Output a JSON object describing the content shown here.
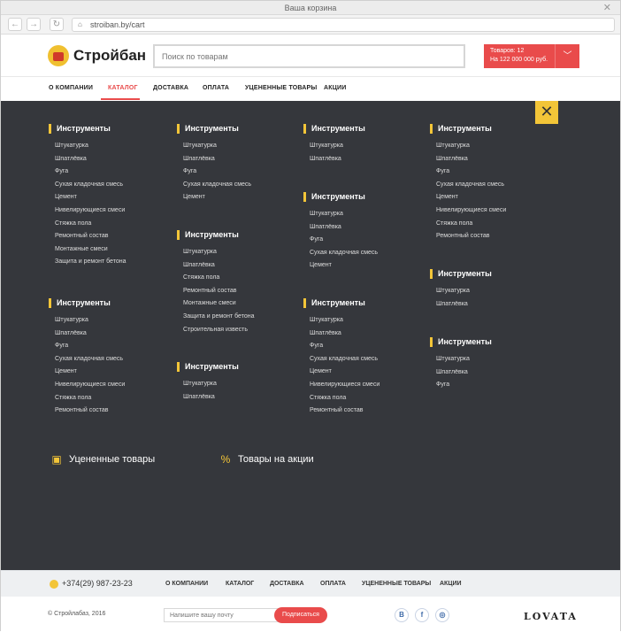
{
  "browser": {
    "title": "Ваша корзина",
    "url": "stroiban.by/cart",
    "back_icon": "←",
    "forward_icon": "→",
    "reload_icon": "↻"
  },
  "header": {
    "brand": "Стройбан",
    "search_placeholder": "Поиск по товарам",
    "cart_line1": "Товаров: 12",
    "cart_line2": "На 122 000 000 руб."
  },
  "nav": [
    "О КОМПАНИИ",
    "КАТАЛОГ",
    "ДОСТАВКА",
    "ОПЛАТА",
    "УЦЕНЕННЫЕ ТОВАРЫ",
    "АКЦИИ"
  ],
  "menu": {
    "groups": [
      {
        "title": "Инструменты",
        "items": [
          "Штукатурка",
          "Шпатлёвка",
          "Фуга",
          "Сухая кладочная смесь",
          "Цемент",
          "Нивелирующиеся смеси",
          "Стяжка пола",
          "Ремонтный состав",
          "Монтажные смеси",
          "Защита и ремонт бетона"
        ]
      },
      {
        "title": "Инструменты",
        "items": [
          "Штукатурка",
          "Шпатлёвка",
          "Фуга",
          "Сухая кладочная смесь",
          "Цемент",
          "Нивелирующиеся смеси",
          "Стяжка пола",
          "Ремонтный состав"
        ]
      },
      {
        "title": "Инструменты",
        "items": [
          "Штукатурка",
          "Шпатлёвка",
          "Фуга",
          "Сухая кладочная смесь",
          "Цемент"
        ]
      },
      {
        "title": "Инструменты",
        "items": [
          "Штукатурка",
          "Шпатлёвка",
          "Стяжка пола",
          "Ремонтный состав",
          "Монтажные смеси",
          "Защита и ремонт бетона",
          "Строительная известь"
        ]
      },
      {
        "title": "Инструменты",
        "items": [
          "Штукатурка",
          "Шпатлёвка"
        ]
      },
      {
        "title": "Инструменты",
        "items": [
          "Штукатурка",
          "Шпатлёвка"
        ]
      },
      {
        "title": "Инструменты",
        "items": [
          "Штукатурка",
          "Шпатлёвка",
          "Фуга",
          "Сухая кладочная смесь",
          "Цемент"
        ]
      },
      {
        "title": "Инструменты",
        "items": [
          "Штукатурка",
          "Шпатлёвка",
          "Фуга",
          "Сухая кладочная смесь",
          "Цемент",
          "Нивелирующиеся смеси",
          "Стяжка пола",
          "Ремонтный состав"
        ]
      },
      {
        "title": "Инструменты",
        "items": [
          "Штукатурка",
          "Шпатлёвка",
          "Фуга",
          "Сухая кладочная смесь",
          "Цемент",
          "Нивелирующиеся смеси",
          "Стяжка пола",
          "Ремонтный состав"
        ]
      },
      {
        "title": "Инструменты",
        "items": [
          "Штукатурка",
          "Шпатлёвка"
        ]
      },
      {
        "title": "Инструменты",
        "items": [
          "Штукатурка",
          "Шпатлёвка",
          "Фуга"
        ]
      }
    ],
    "discounted": "Уцененные товары",
    "promo": "Товары на акции",
    "close_icon": "✕"
  },
  "footer": {
    "phone": "+374(29) 987-23-23",
    "nav": [
      "О КОМПАНИИ",
      "КАТАЛОГ",
      "ДОСТАВКА",
      "ОПЛАТА",
      "УЦЕНЕННЫЕ ТОВАРЫ",
      "АКЦИИ"
    ],
    "copyright": "© Стройлабаз, 2016",
    "email_placeholder": "Напишите вашу почту",
    "subscribe": "Подписаться",
    "social": [
      "B",
      "f",
      "◎"
    ],
    "brand": "LOVATA"
  },
  "colors": {
    "accent": "#e94b4b",
    "yellow": "#f3c538",
    "dark": "#35373c"
  }
}
